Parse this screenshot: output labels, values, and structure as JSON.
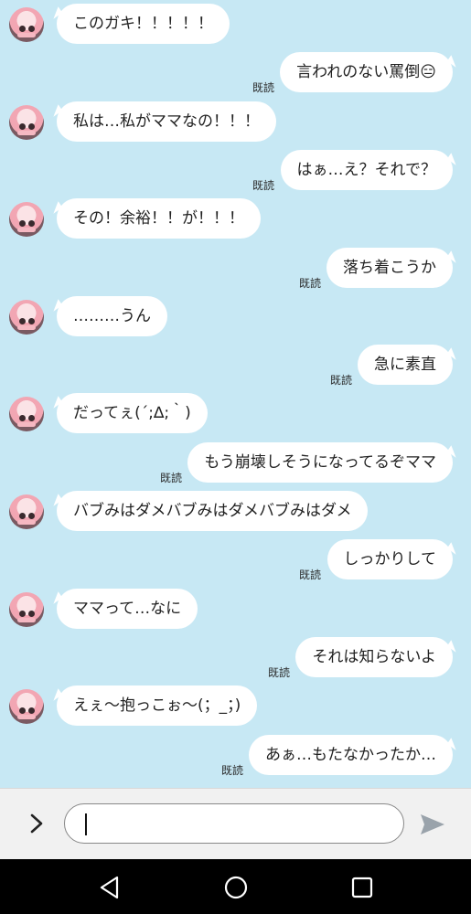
{
  "colors": {
    "chat_background": "#c7e8f4",
    "bubble": "#ffffff",
    "text": "#222222"
  },
  "messages": [
    {
      "side": "in",
      "text": "このガキ！！！！！"
    },
    {
      "side": "out",
      "text": "言われのない罵倒😑",
      "read": "既読"
    },
    {
      "side": "in",
      "text": "私は…私がママなの！！！"
    },
    {
      "side": "out",
      "text": "はぁ…え？それで？",
      "read": "既読"
    },
    {
      "side": "in",
      "text": "その！余裕！！が！！！"
    },
    {
      "side": "out",
      "text": "落ち着こうか",
      "read": "既読"
    },
    {
      "side": "in",
      "text": "………うん"
    },
    {
      "side": "out",
      "text": "急に素直",
      "read": "既読"
    },
    {
      "side": "in",
      "text": "だってぇ(´;∆;｀)"
    },
    {
      "side": "out",
      "text": "もう崩壊しそうになってるぞママ",
      "read": "既読"
    },
    {
      "side": "in",
      "text": "バブみはダメバブみはダメバブみはダメ"
    },
    {
      "side": "out",
      "text": "しっかりして",
      "read": "既読"
    },
    {
      "side": "in",
      "text": "ママって…なに"
    },
    {
      "side": "out",
      "text": "それは知らないよ",
      "read": "既読"
    },
    {
      "side": "in",
      "text": "えぇ〜抱っこぉ〜(；_；)"
    },
    {
      "side": "out",
      "text": "あぁ…もたなかったか…",
      "read": "既読"
    }
  ],
  "input": {
    "value": "",
    "menu_icon": "chevron-right-icon",
    "send_icon": "send-icon"
  },
  "nav": {
    "back_icon": "back-triangle-icon",
    "home_icon": "home-circle-icon",
    "recents_icon": "recents-square-icon"
  }
}
